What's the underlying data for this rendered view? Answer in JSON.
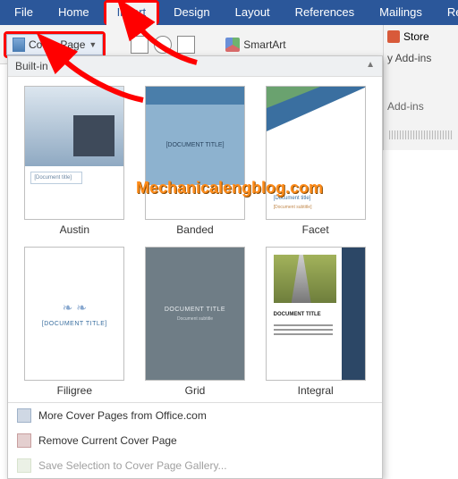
{
  "tabs": {
    "file": "File",
    "home": "Home",
    "insert": "Insert",
    "design": "Design",
    "layout": "Layout",
    "references": "References",
    "mailings": "Mailings",
    "review": "Revie"
  },
  "ribbon": {
    "cover_page": "Cover Page",
    "smartart": "SmartArt",
    "store": "Store",
    "my_addins": "y Add-ins",
    "addins_label": "Add-ins"
  },
  "gallery": {
    "header": "Built-in",
    "thumbs": {
      "austin": "Austin",
      "austin_doc": "[Document title]",
      "banded": "Banded",
      "banded_doc": "[DOCUMENT TITLE]",
      "facet": "Facet",
      "facet_doc": "[Document title]",
      "facet_sub": "[Document subtitle]",
      "filigree": "Filigree",
      "filigree_doc": "[DOCUMENT TITLE]",
      "grid": "Grid",
      "grid_doc": "DOCUMENT TITLE",
      "grid_sub": "Document subtitle",
      "integral": "Integral",
      "integral_doc": "DOCUMENT TITLE"
    },
    "menu": {
      "more": "More Cover Pages from Office.com",
      "remove": "Remove Current Cover Page",
      "save": "Save Selection to Cover Page Gallery..."
    }
  },
  "watermark": "Mechanicalengblog.com"
}
